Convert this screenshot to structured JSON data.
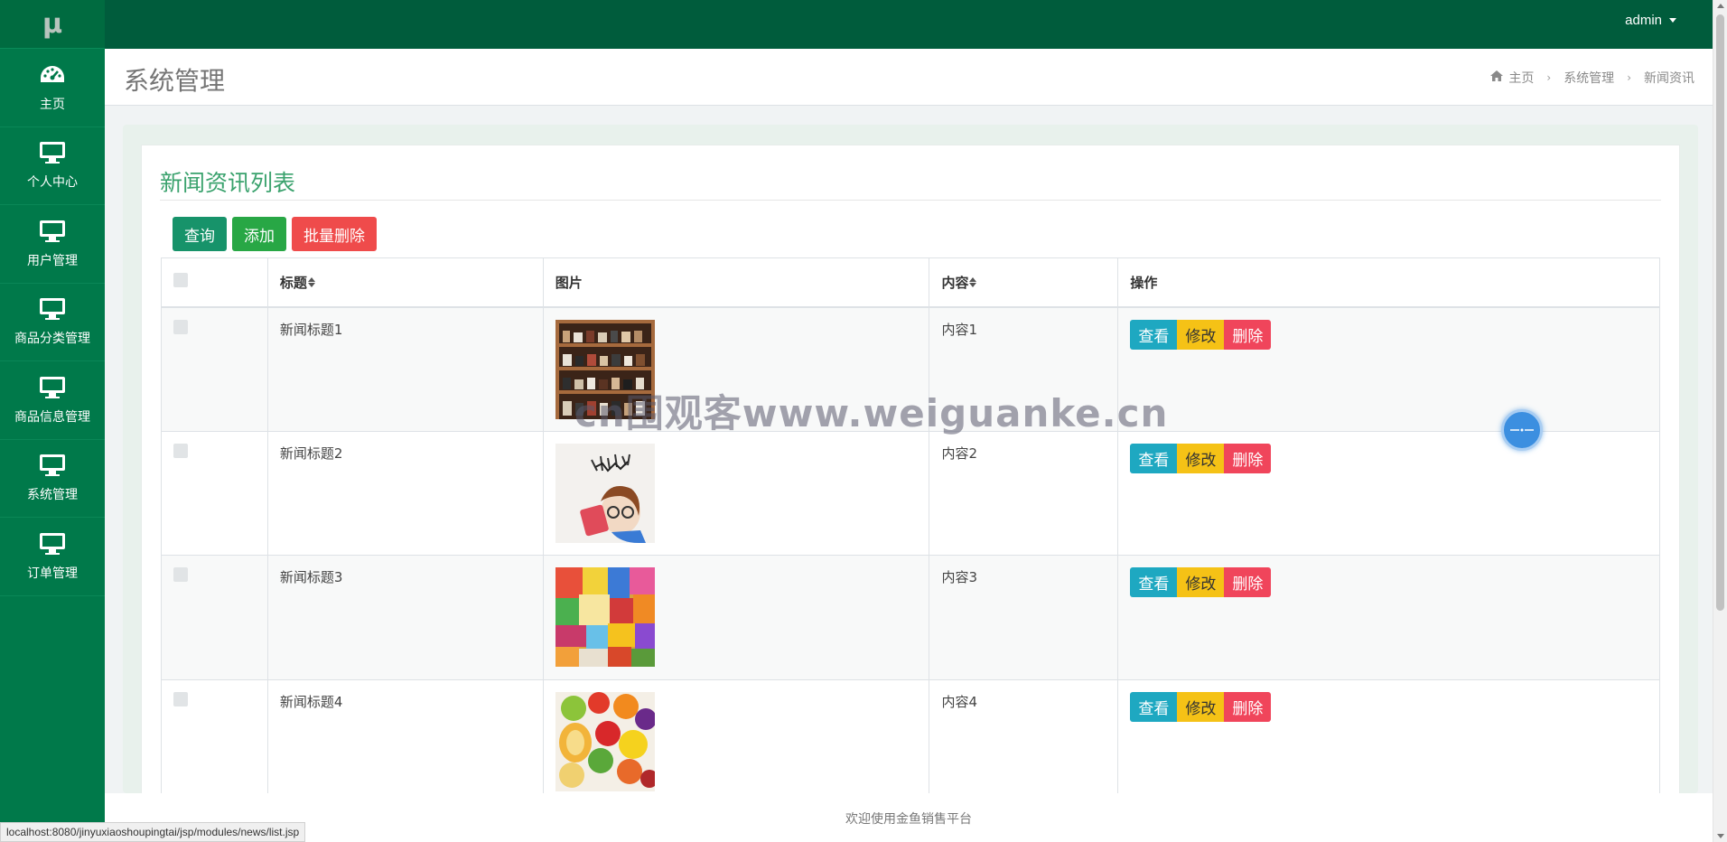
{
  "logo": "μ",
  "sidebar": {
    "items": [
      {
        "label": "主页",
        "icon": "dashboard-icon"
      },
      {
        "label": "个人中心",
        "icon": "monitor-icon"
      },
      {
        "label": "用户管理",
        "icon": "monitor-icon"
      },
      {
        "label": "商品分类管理",
        "icon": "monitor-icon"
      },
      {
        "label": "商品信息管理",
        "icon": "monitor-icon"
      },
      {
        "label": "系统管理",
        "icon": "monitor-icon"
      },
      {
        "label": "订单管理",
        "icon": "monitor-icon"
      }
    ]
  },
  "topbar": {
    "user": "admin"
  },
  "header": {
    "title": "系统管理",
    "breadcrumb": [
      "主页",
      "系统管理",
      "新闻资讯"
    ]
  },
  "card": {
    "title": "新闻资讯列表",
    "buttons": {
      "query": "查询",
      "add": "添加",
      "batch_delete": "批量删除"
    }
  },
  "table": {
    "columns": {
      "title": "标题",
      "image": "图片",
      "content": "内容",
      "actions": "操作"
    },
    "rows": [
      {
        "title": "新闻标题1",
        "content": "内容1",
        "image": "shoe-rack-photo"
      },
      {
        "title": "新闻标题2",
        "content": "内容2",
        "image": "cartoon-girl-photo"
      },
      {
        "title": "新闻标题3",
        "content": "内容3",
        "image": "snacks-photo"
      },
      {
        "title": "新闻标题4",
        "content": "内容4",
        "image": "fruit-photo"
      }
    ],
    "row_actions": {
      "view": "查看",
      "edit": "修改",
      "delete": "删除"
    }
  },
  "footer": {
    "text": "欢迎使用金鱼销售平台"
  },
  "statusbar": {
    "url": "localhost:8080/jinyuxiaoshoupingtai/jsp/modules/news/list.jsp"
  },
  "watermark": "cn围观客www.weiguanke.cn",
  "colors": {
    "sidebar": "#00794a",
    "topbar": "#005c3c",
    "accent": "#3aa26d",
    "danger": "#ef4b4b",
    "warning": "#f5c216",
    "info": "#1ea8c1"
  }
}
